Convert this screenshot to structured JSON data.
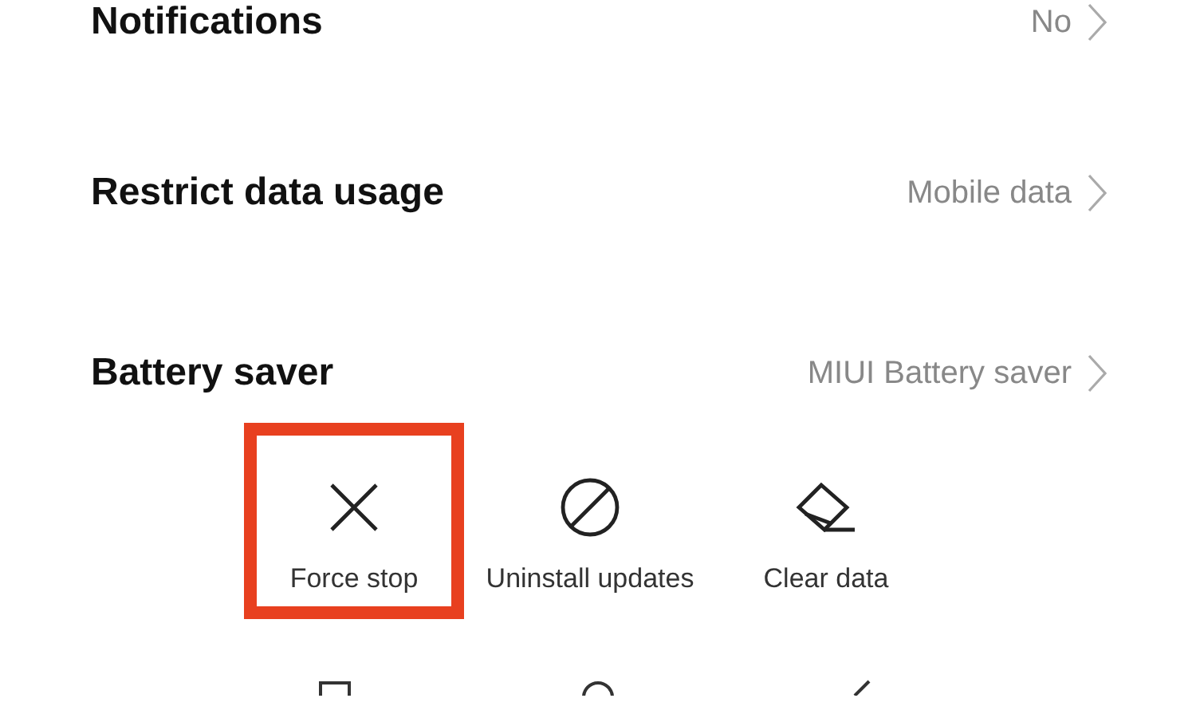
{
  "settings": [
    {
      "label": "Notifications",
      "value": "No"
    },
    {
      "label": "Restrict data usage",
      "value": "Mobile data"
    },
    {
      "label": "Battery saver",
      "value": "MIUI Battery saver"
    }
  ],
  "actions": [
    {
      "kind": "force-stop",
      "label": "Force stop",
      "highlighted": true
    },
    {
      "kind": "uninstall-updates",
      "label": "Uninstall updates",
      "highlighted": false
    },
    {
      "kind": "clear-data",
      "label": "Clear data",
      "highlighted": false
    }
  ],
  "nav_bar": [
    {
      "kind": "recents"
    },
    {
      "kind": "home"
    },
    {
      "kind": "back"
    }
  ]
}
